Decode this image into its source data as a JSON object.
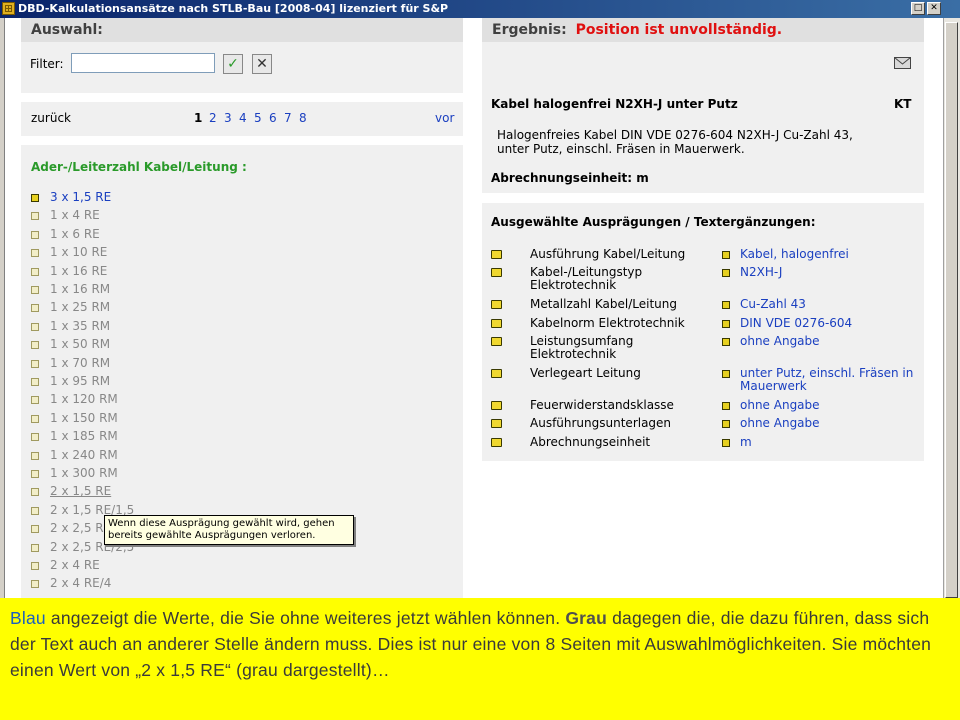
{
  "window": {
    "title": "DBD-Kalkulationsansätze nach STLB-Bau [2008-04] lizenziert für S&P",
    "btn_minmax": "□",
    "btn_close": "✕"
  },
  "left": {
    "auswahl_header": "Auswahl:",
    "filter_label": "Filter:",
    "filter_value": "",
    "ok_glyph": "✓",
    "clear_glyph": "✕",
    "back": "zurück",
    "pages": [
      "1",
      "2",
      "3",
      "4",
      "5",
      "6",
      "7",
      "8"
    ],
    "forward": "vor",
    "group_title": "Ader-/Leiterzahl Kabel/Leitung :",
    "items": [
      "3 x 1,5 RE",
      "1 x 4 RE",
      "1 x 6 RE",
      "1 x 10 RE",
      "1 x 16 RE",
      "1 x 16 RM",
      "1 x 25 RM",
      "1 x 35 RM",
      "1 x 50 RM",
      "1 x 70 RM",
      "1 x 95 RM",
      "1 x 120 RM",
      "1 x 150 RM",
      "1 x 185 RM",
      "1 x 240 RM",
      "1 x 300 RM",
      "2 x 1,5 RE",
      "2 x 1,5 RE/1,5",
      "2 x 2,5 RE",
      "2 x 2,5 RE/2,5",
      "2 x 4 RE",
      "2 x 4 RE/4"
    ],
    "tooltip": "Wenn diese Ausprägung gewählt wird, gehen bereits gewählte Ausprägungen verloren."
  },
  "right": {
    "ergebnis_label": "Ergebnis:",
    "status": "Position ist unvollständig.",
    "mail_icon": "envelope-icon",
    "position_title": "Kabel halogenfrei N2XH-J unter Putz",
    "kt": "KT",
    "desc_line1": "Halogenfreies Kabel DIN VDE 0276-604 N2XH-J Cu-Zahl 43,",
    "desc_line2": "unter Putz, einschl. Fräsen in Mauerwerk.",
    "unit_line": "Abrechnungseinheit: m",
    "features_header": "Ausgewählte Ausprägungen / Textergänzungen:",
    "features": [
      {
        "label": "Ausführung Kabel/Leitung",
        "value": "Kabel, halogenfrei"
      },
      {
        "label": "Kabel-/Leitungstyp Elektrotechnik",
        "value": "N2XH-J"
      },
      {
        "label": "Metallzahl Kabel/Leitung",
        "value": "Cu-Zahl 43"
      },
      {
        "label": "Kabelnorm Elektrotechnik",
        "value": "DIN VDE 0276-604"
      },
      {
        "label": "Leistungsumfang Elektrotechnik",
        "value": "ohne Angabe"
      },
      {
        "label": "Verlegeart Leitung",
        "value": "unter Putz, einschl. Fräsen in Mauerwerk"
      },
      {
        "label": "Feuerwiderstandsklasse",
        "value": "ohne Angabe"
      },
      {
        "label": "Ausführungsunterlagen",
        "value": "ohne Angabe"
      },
      {
        "label": "Abrechnungseinheit",
        "value": "m"
      }
    ]
  },
  "banner": {
    "w_blau": "Blau",
    "t1": " angezeigt die Werte, die Sie ohne weiteres jetzt wählen können. ",
    "w_grau": "Grau",
    "t2": " dagegen die, die dazu führen, dass sich der Text auch an anderer Stelle ändern muss. Dies ist nur eine von 8 Seiten mit Auswahlmöglichkeiten. Sie möchten einen Wert von „2 x 1,5 RE“ (grau dargestellt)…"
  },
  "colors": {
    "blue": "#1a3fc0",
    "gray": "#888888",
    "green": "#2a9a2a",
    "red": "#e01010",
    "banner": "#ffff00"
  }
}
